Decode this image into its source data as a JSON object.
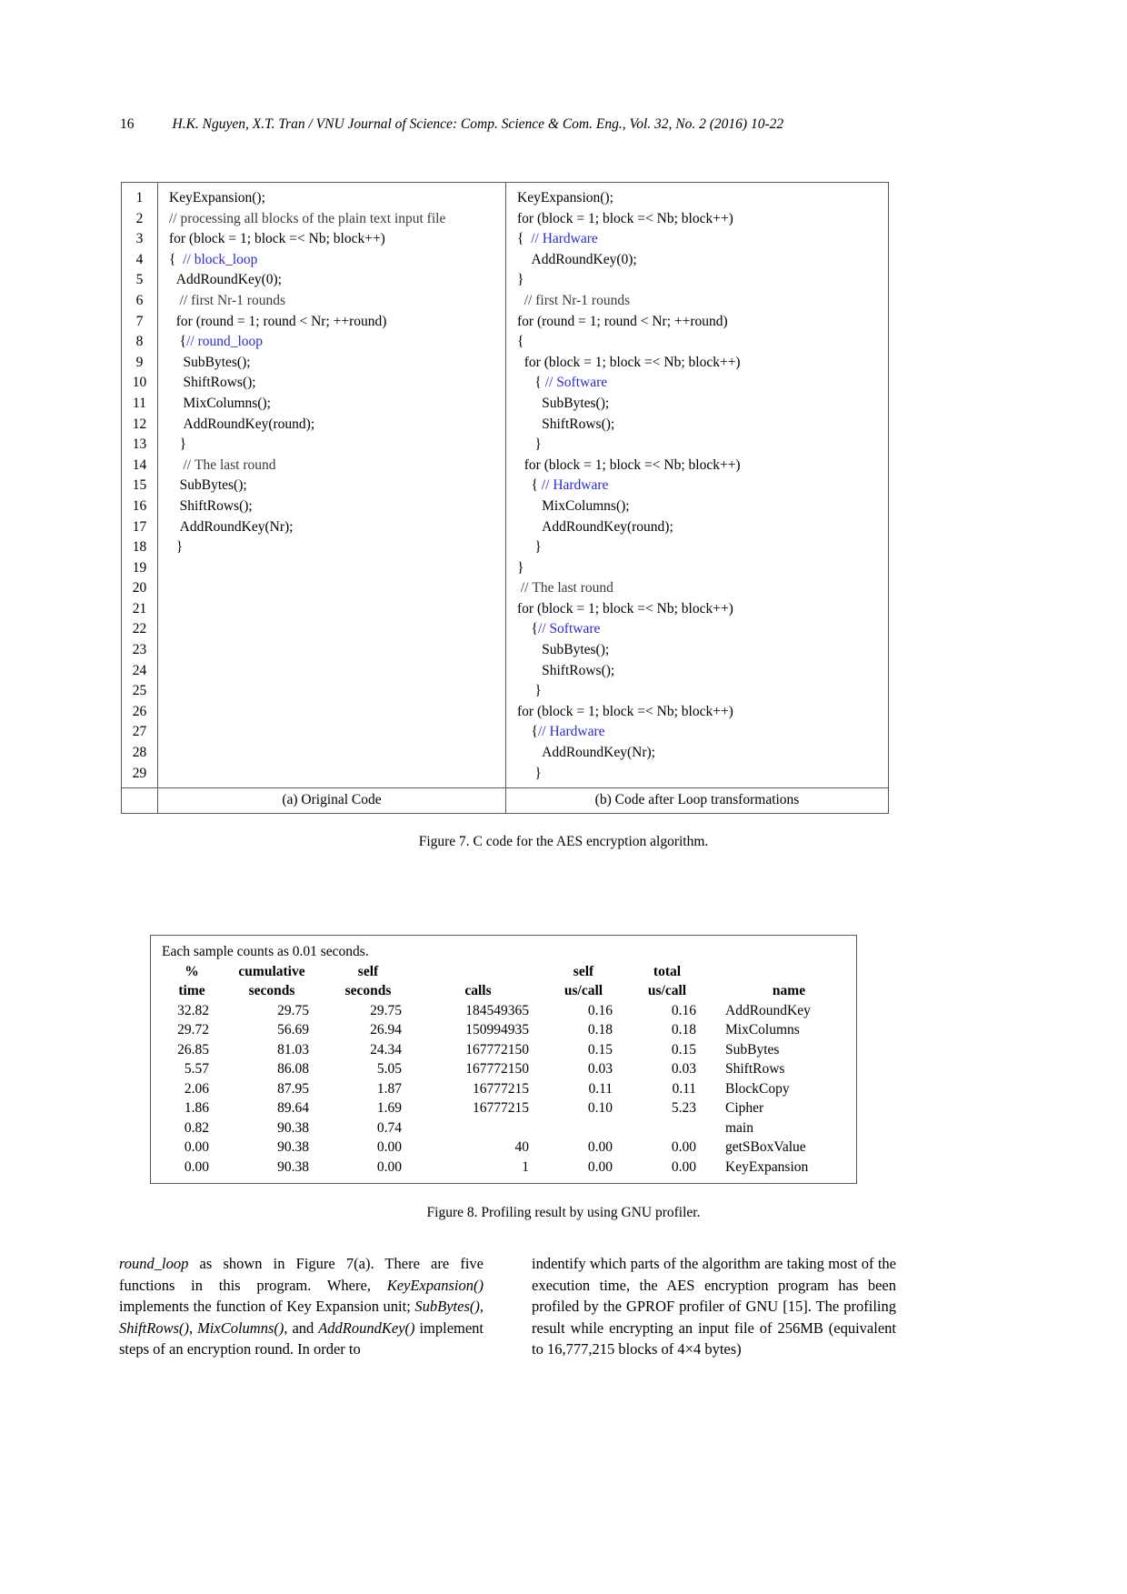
{
  "running_head": {
    "page_number": "16",
    "text": "H.K. Nguyen, X.T. Tran / VNU Journal of Science: Comp. Science & Com. Eng., Vol. 32, No. 2 (2016) 10-22"
  },
  "figure7": {
    "caption": "Figure 7. C code for the AES encryption algorithm.",
    "line_numbers": [
      "1",
      "2",
      "3",
      "4",
      "5",
      "6",
      "7",
      "8",
      "9",
      "10",
      "11",
      "12",
      "13",
      "14",
      "15",
      "16",
      "17",
      "18",
      "19",
      "20",
      "21",
      "22",
      "23",
      "24",
      "25",
      "26",
      "27",
      "28",
      "29"
    ],
    "column_a_caption": "(a) Original Code",
    "column_b_caption": "(b) Code after Loop transformations",
    "column_a_lines": [
      "KeyExpansion();",
      "// processing all blocks of the plain text input file",
      "for (block = 1; block =< Nb; block++)",
      "{  // block_loop",
      "  AddRoundKey(0);",
      "   // first Nr-1 rounds",
      "  for (round = 1; round < Nr; ++round)",
      "   {// round_loop",
      "    SubBytes();",
      "    ShiftRows();",
      "    MixColumns();",
      "    AddRoundKey(round);",
      "   }",
      "    // The last round",
      "   SubBytes();",
      "   ShiftRows();",
      "   AddRoundKey(Nr);",
      "  }",
      "",
      "",
      "",
      "",
      "",
      "",
      "",
      "",
      "",
      "",
      ""
    ],
    "column_b_lines": [
      "KeyExpansion();",
      "for (block = 1; block =< Nb; block++)",
      "{  // Hardware",
      "    AddRoundKey(0);",
      "}",
      "  // first Nr-1 rounds",
      "for (round = 1; round < Nr; ++round)",
      "{",
      "  for (block = 1; block =< Nb; block++)",
      "     { // Software",
      "       SubBytes();",
      "       ShiftRows();",
      "     }",
      "  for (block = 1; block =< Nb; block++)",
      "    { // Hardware",
      "       MixColumns();",
      "       AddRoundKey(round);",
      "     }",
      "}",
      " // The last round",
      "for (block = 1; block =< Nb; block++)",
      "    {// Software",
      "       SubBytes();",
      "       ShiftRows();",
      "     }",
      "for (block = 1; block =< Nb; block++)",
      "    {// Hardware",
      "       AddRoundKey(Nr);",
      "     }"
    ]
  },
  "figure8": {
    "caption": "Figure 8. Profiling result by using GNU profiler.",
    "note": "Each sample counts as 0.01 seconds.",
    "headers_row1": [
      "%",
      "cumulative",
      "self",
      "",
      "self",
      "total",
      ""
    ],
    "headers_row2": [
      "time",
      "seconds",
      "seconds",
      "calls",
      "us/call",
      "us/call",
      "name"
    ],
    "rows": [
      [
        "32.82",
        "29.75",
        "29.75",
        "184549365",
        "0.16",
        "0.16",
        "AddRoundKey"
      ],
      [
        "29.72",
        "56.69",
        "26.94",
        "150994935",
        "0.18",
        "0.18",
        "MixColumns"
      ],
      [
        "26.85",
        "81.03",
        "24.34",
        "167772150",
        "0.15",
        "0.15",
        "SubBytes"
      ],
      [
        "5.57",
        "86.08",
        "5.05",
        "167772150",
        "0.03",
        "0.03",
        "ShiftRows"
      ],
      [
        "2.06",
        "87.95",
        "1.87",
        "16777215",
        "0.11",
        "0.11",
        "BlockCopy"
      ],
      [
        "1.86",
        "89.64",
        "1.69",
        "16777215",
        "0.10",
        "5.23",
        "Cipher"
      ],
      [
        "0.82",
        "90.38",
        "0.74",
        "",
        "",
        "",
        "main"
      ],
      [
        "0.00",
        "90.38",
        "0.00",
        "40",
        "0.00",
        "0.00",
        "getSBoxValue"
      ],
      [
        "0.00",
        "90.38",
        "0.00",
        "1",
        "0.00",
        "0.00",
        "KeyExpansion"
      ]
    ]
  },
  "body": {
    "left_column": "round_loop as shown in Figure 7(a). There are five functions in this program. Where, KeyExpansion() implements the function of Key Expansion unit; SubBytes(), ShiftRows(), MixColumns(), and AddRoundKey() implement steps of an encryption round. In order to",
    "right_column": "indentify which parts of the algorithm are taking most of the execution time, the AES encryption program has been profiled by the GPROF profiler of GNU [15]. The profiling result while encrypting an input file of 256MB (equivalent to 16,777,215 blocks of 4×4 bytes)"
  },
  "colors": {
    "text": "#000000",
    "comment_highlight": "#2b2bd0",
    "rule": "#5a5a5a"
  }
}
